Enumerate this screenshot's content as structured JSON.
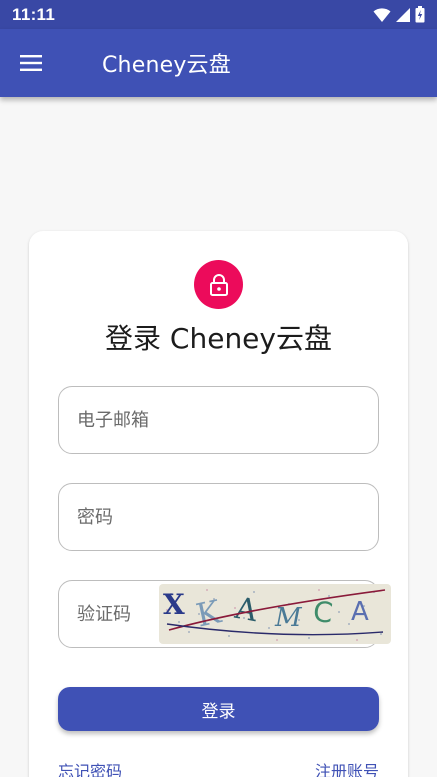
{
  "status_bar": {
    "time": "11:11",
    "icons": [
      "wifi-icon",
      "signal-icon",
      "battery-icon"
    ]
  },
  "app_bar": {
    "menu_icon": "menu-icon",
    "title": "Cheney云盘"
  },
  "login_card": {
    "avatar_icon": "lock-icon",
    "heading": "登录 Cheney云盘",
    "email_placeholder": "电子邮箱",
    "password_placeholder": "密码",
    "captcha_placeholder": "验证码",
    "captcha_text": "XKAMCA",
    "login_button": "登录",
    "forgot_password": "忘记密码",
    "register": "注册账号"
  },
  "colors": {
    "primary": "#3f51b5",
    "status_bar": "#3948a5",
    "accent": "#ec0b5b",
    "background": "#f7f7f7"
  }
}
